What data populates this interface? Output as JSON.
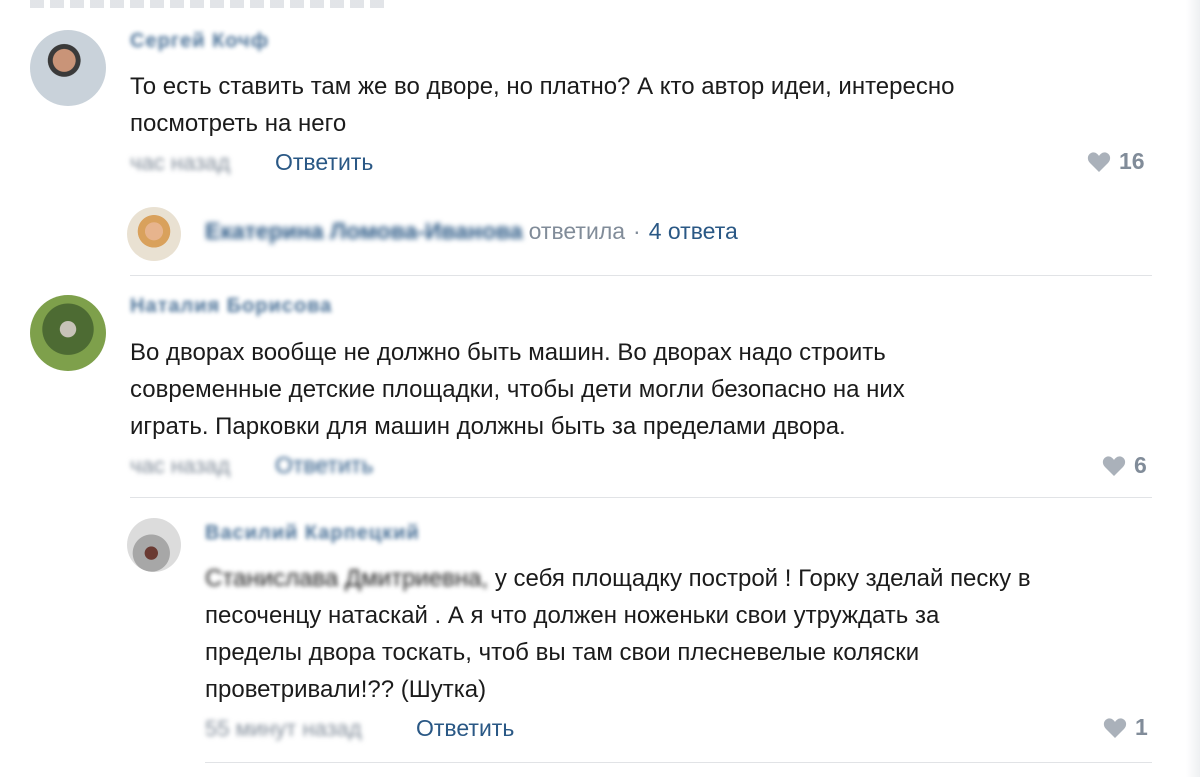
{
  "comments": [
    {
      "author": "Сергей Кочф",
      "text_line1": "То есть ставить там же во дворе, но платно? А кто автор идеи, интересно",
      "text_line2": "посмотреть на него",
      "time": "час назад",
      "reply_label": "Ответить",
      "likes": "16",
      "thread": {
        "author": "Екатерина Ломова-Иванова",
        "action": "ответила",
        "separator": "·",
        "replies_label": "4 ответа"
      }
    },
    {
      "author": "Наталия Борисова",
      "text_line1": "Во дворах вообще не должно быть машин. Во дворах надо строить",
      "text_line2": "современные детские площадки, чтобы дети могли безопасно на них",
      "text_line3": "играть. Парковки для машин должны быть за пределами двора.",
      "time": "час назад",
      "reply_label": "Ответить",
      "likes": "6"
    },
    {
      "author": "Василий Карпецкий",
      "text_prefix": "Станислава Дмитриевна,",
      "text_line1": "у себя площадку построй ! Горку зделай песку в",
      "text_line2": "песоченцу натаскай . А я что должен ноженьки свои утруждать за",
      "text_line3": "пределы двора тоскать, чтоб вы там свои плесневелые коляски",
      "text_line4": "проветривали!?? (Шутка)",
      "time": "55 минут назад",
      "reply_label": "Ответить",
      "likes": "1"
    }
  ],
  "colors": {
    "link": "#2a5885",
    "meta": "#818c99",
    "text": "#1b1b1b",
    "divider": "#e1e3e6"
  },
  "icons": {
    "like": "heart-icon"
  }
}
